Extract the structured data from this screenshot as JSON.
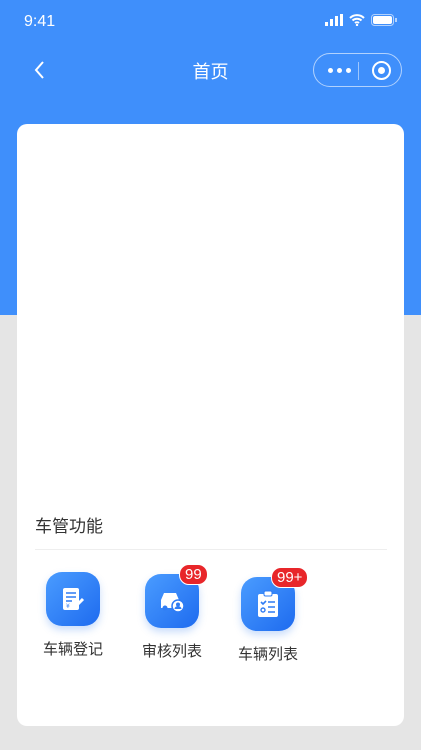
{
  "status_bar": {
    "time": "9:41"
  },
  "nav": {
    "title": "首页"
  },
  "section": {
    "title": "车管功能"
  },
  "functions": [
    {
      "label": "车辆登记",
      "icon": "document-pen-icon",
      "badge": null
    },
    {
      "label": "审核列表",
      "icon": "car-user-icon",
      "badge": "99"
    },
    {
      "label": "车辆列表",
      "icon": "clipboard-list-icon",
      "badge": "99+"
    }
  ],
  "colors": {
    "primary": "#3f8ffb",
    "badge": "#e8262a"
  }
}
